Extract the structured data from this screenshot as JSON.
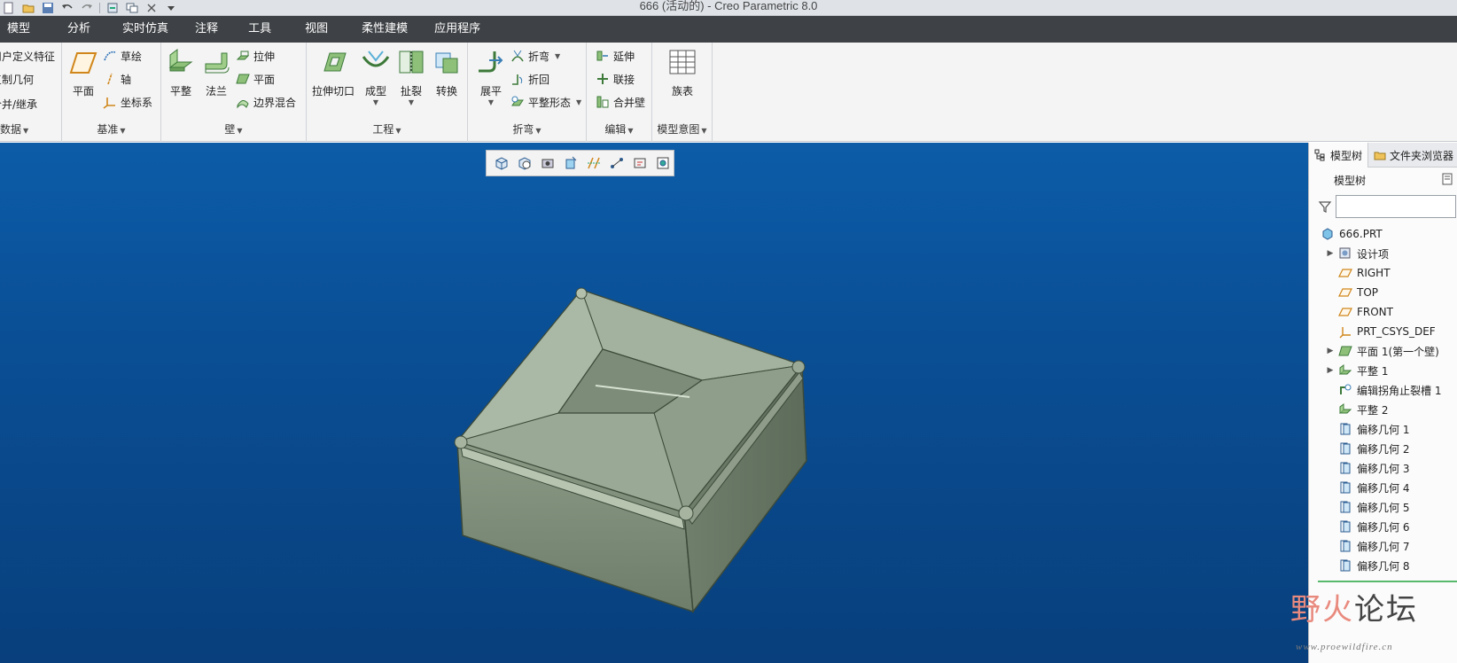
{
  "window": {
    "title": "666 (活动的) - Creo Parametric 8.0"
  },
  "quick_access": {
    "icons": [
      "new-icon",
      "open-icon",
      "save-icon",
      "undo-icon",
      "redo-icon",
      "regenerate-icon",
      "windows-icon",
      "close-icon",
      "customize-icon"
    ]
  },
  "menu": {
    "tabs": [
      "模型",
      "分析",
      "实时仿真",
      "注释",
      "工具",
      "视图",
      "柔性建模",
      "应用程序"
    ]
  },
  "ribbon": {
    "get_data": {
      "label": "取数据",
      "items": [
        "用户定义特征",
        "复制几何",
        "合并/继承"
      ]
    },
    "datum": {
      "label": "基准",
      "plane": "平面",
      "sketch": "草绘",
      "axis": "轴",
      "csys": "坐标系"
    },
    "walls": {
      "label": "壁",
      "flat": "平整",
      "flange": "法兰",
      "extrude": "拉伸",
      "planar": "平面",
      "boundary_blend": "边界混合"
    },
    "engineering": {
      "label": "工程",
      "extrude_cut": "拉伸切口",
      "form": "成型",
      "rip": "扯裂",
      "convert": "转换"
    },
    "bends": {
      "label": "折弯",
      "unbend": "展平",
      "bend": "折弯",
      "bend_back": "折回",
      "flat_pattern": "平整形态"
    },
    "editing": {
      "label": "编辑",
      "extend": "延伸",
      "join": "联接",
      "merge_walls": "合并壁"
    },
    "design_intent": {
      "label": "模型意图",
      "family_table": "族表"
    }
  },
  "view_toolbar": {
    "icons": [
      "refit-icon",
      "zoom-in-icon",
      "saved-views-icon",
      "display-style-icon",
      "datum-display-icon",
      "annotation-display-icon",
      "spin-center-icon",
      "appearance-icon"
    ]
  },
  "panel": {
    "tabs": [
      "模型树",
      "文件夹浏览器"
    ],
    "header": "模型树",
    "filter_placeholder": "",
    "tree": [
      {
        "label": "666.PRT",
        "icon": "part-icon",
        "expandable": false,
        "indent": 0
      },
      {
        "label": "设计项",
        "icon": "design-items-icon",
        "expandable": true,
        "indent": 1
      },
      {
        "label": "RIGHT",
        "icon": "datum-plane-icon",
        "expandable": false,
        "indent": 1
      },
      {
        "label": "TOP",
        "icon": "datum-plane-icon",
        "expandable": false,
        "indent": 1
      },
      {
        "label": "FRONT",
        "icon": "datum-plane-icon",
        "expandable": false,
        "indent": 1
      },
      {
        "label": "PRT_CSYS_DEF",
        "icon": "csys-icon",
        "expandable": false,
        "indent": 1
      },
      {
        "label": "平面 1(第一个壁)",
        "icon": "planar-wall-icon",
        "expandable": true,
        "indent": 1
      },
      {
        "label": "平整 1",
        "icon": "flat-wall-icon",
        "expandable": true,
        "indent": 1
      },
      {
        "label": "编辑拐角止裂槽 1",
        "icon": "corner-relief-icon",
        "expandable": false,
        "indent": 1
      },
      {
        "label": "平整 2",
        "icon": "flat-wall-icon",
        "expandable": false,
        "indent": 1
      },
      {
        "label": "偏移几何 1",
        "icon": "offset-geometry-icon",
        "expandable": false,
        "indent": 1
      },
      {
        "label": "偏移几何 2",
        "icon": "offset-geometry-icon",
        "expandable": false,
        "indent": 1
      },
      {
        "label": "偏移几何 3",
        "icon": "offset-geometry-icon",
        "expandable": false,
        "indent": 1
      },
      {
        "label": "偏移几何 4",
        "icon": "offset-geometry-icon",
        "expandable": false,
        "indent": 1
      },
      {
        "label": "偏移几何 5",
        "icon": "offset-geometry-icon",
        "expandable": false,
        "indent": 1
      },
      {
        "label": "偏移几何 6",
        "icon": "offset-geometry-icon",
        "expandable": false,
        "indent": 1
      },
      {
        "label": "偏移几何 7",
        "icon": "offset-geometry-icon",
        "expandable": false,
        "indent": 1
      },
      {
        "label": "偏移几何 8",
        "icon": "offset-geometry-icon",
        "expandable": false,
        "indent": 1
      }
    ]
  },
  "watermark": {
    "text_a": "野火",
    "text_b": "论坛",
    "url": "www.proewildfire.cn"
  },
  "colors": {
    "menubar": "#3e4145",
    "viewport_top": "#0c5ca8",
    "viewport_bottom": "#083f7c",
    "model_face": "#9aa893"
  }
}
